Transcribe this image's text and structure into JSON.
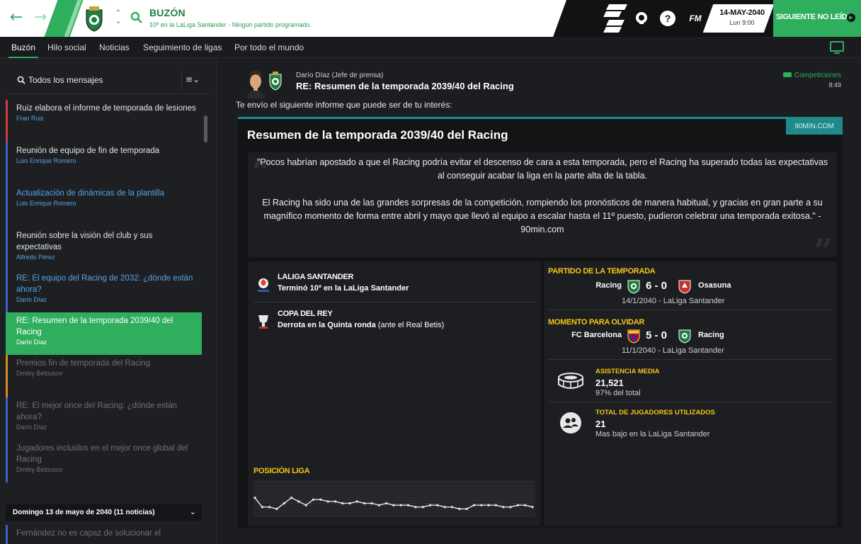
{
  "topbar": {
    "title": "BUZÓN",
    "subtitle": "10º en la LaLiga Santander - Ningún partido programado.",
    "date": "14-MAY-2040",
    "day_time": "Lun 9:00",
    "fm_logo": "FM",
    "help_glyph": "?",
    "continue_label": "SIGUIENTE NO LEÍDO",
    "back_glyph": "←",
    "forward_glyph": "→",
    "accent": "#2fae5e"
  },
  "subnav": {
    "tabs": [
      "Buzón",
      "Hilo social",
      "Noticias",
      "Seguimiento de ligas",
      "Por todo el mundo"
    ],
    "active_tab": "Buzón"
  },
  "inbox": {
    "filter_label": "Todos los mensajes",
    "menu_glyph": "≡⌄",
    "messages": [
      {
        "title": "Ruiz elabora el informe de temporada de lesiones",
        "author": "Fran Ruiz",
        "state": "unread",
        "color": "#d23a3a"
      },
      {
        "title": "Reunión de equipo de fin de temporada",
        "author": "Luis Enrique Romero",
        "state": "unread",
        "color": "#3a62c8"
      },
      {
        "title": "Actualización de dinámicas de la plantilla",
        "author": "Luis Enrique Romero",
        "state": "new",
        "color": "#3a62c8"
      },
      {
        "title": "Reunión sobre la visión del club y sus expectativas",
        "author": "Alfredo Pérez",
        "state": "unread",
        "color": "#3a62c8"
      },
      {
        "title": "RE: El equipo del Racing de 2032: ¿dónde están ahora?",
        "author": "Darío Díaz",
        "state": "new",
        "color": "#3a62c8"
      },
      {
        "title": "RE: Resumen de la temporada 2039/40 del Racing",
        "author": "Darío Díaz",
        "state": "selected",
        "color": "#2fae5e"
      },
      {
        "title": "Premios fin de temporada del Racing",
        "author": "Dmitry Belousov",
        "state": "read",
        "color": "#d98a1f"
      },
      {
        "title": "RE: El mejor once del Racing: ¿dónde están ahora?",
        "author": "Darío Díaz",
        "state": "read",
        "color": "#3a62c8"
      },
      {
        "title": "Jugadores incluidos en el mejor once global del Racing",
        "author": "Dmitry Belousov",
        "state": "read",
        "color": "#3a62c8"
      }
    ],
    "day_header": "Domingo 13 de mayo de 2040 (11 noticias)",
    "last_message": "Fernández no es capaz de solucionar el"
  },
  "message": {
    "from": "Darío Díaz  (Jefe de prensa)",
    "subject": "RE: Resumen de la temporada 2039/40 del Racing",
    "category": "Competiciones",
    "time": "8:49",
    "intro": "Te envío el siguiente informe que puede ser de tu interés:",
    "source": "90MIN.COM",
    "article_title": "Resumen de la temporada 2039/40 del Racing",
    "quote_p1": "\"Pocos habrían apostado a que el Racing podría evitar el descenso de cara a esta temporada, pero el Racing ha superado todas las expectativas al conseguir acabar la liga en la parte alta de la tabla.",
    "quote_p2": "El Racing ha sido una de las grandes sorpresas de la competición, rompiendo los pronósticos de manera habitual, y gracias en gran parte a su magnífico momento de forma entre abril y mayo que llevó al equipo a escalar hasta el 11º puesto, pudieron celebrar una temporada exitosa.\" - 90min.com"
  },
  "competitions": [
    {
      "name": "LALIGA SANTANDER",
      "result_bold": "Terminó 10º en la LaLiga Santander",
      "result_rest": ""
    },
    {
      "name": "COPA DEL REY",
      "result_bold": "Derrota en la Quinta ronda",
      "result_rest": " (ante el Real Betis)"
    }
  ],
  "position_chart": {
    "label": "POSICIÓN LIGA",
    "matchdays": 38,
    "positions": [
      10,
      15,
      15,
      16,
      13,
      10,
      12,
      14,
      11,
      11,
      12,
      12,
      13,
      13,
      12,
      13,
      13,
      14,
      13,
      14,
      14,
      14,
      15,
      15,
      14,
      14,
      15,
      15,
      16,
      16,
      14,
      14,
      14,
      14,
      15,
      15,
      14,
      14,
      15
    ]
  },
  "season_stats": {
    "best_match": {
      "label": "PARTIDO DE LA TEMPORADA",
      "home": "Racing",
      "score": "6 - 0",
      "away": "Osasuna",
      "meta": "14/1/2040  -  LaLiga Santander"
    },
    "worst_match": {
      "label": "MOMENTO PARA OLVIDAR",
      "home": "FC Barcelona",
      "score": "5 - 0",
      "away": "Racing",
      "meta": "11/1/2040  -  LaLiga Santander"
    },
    "attendance": {
      "label": "ASISTENCIA MEDIA",
      "value": "21,521",
      "sub": "97% del total"
    },
    "players_used": {
      "label": "TOTAL DE JUGADORES UTILIZADOS",
      "value": "21",
      "sub": "Mas bajo en la LaLiga Santander"
    }
  }
}
